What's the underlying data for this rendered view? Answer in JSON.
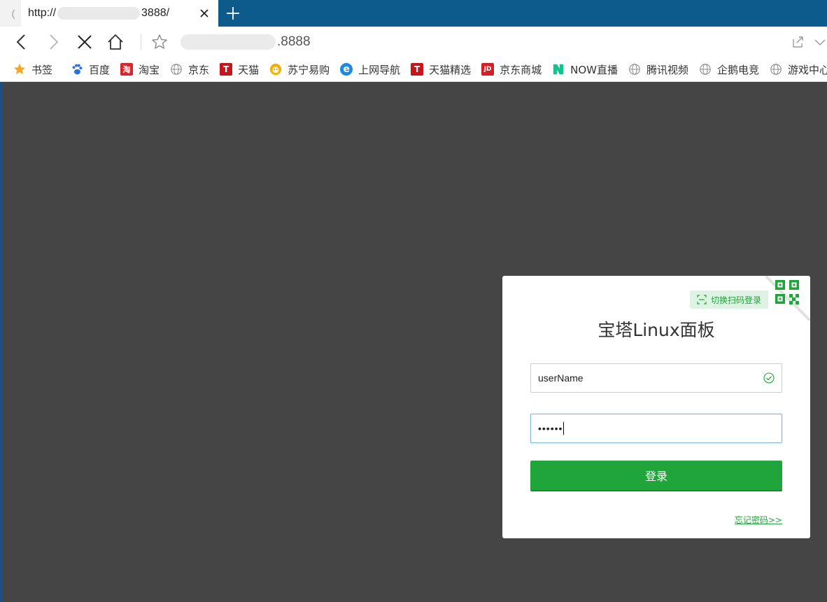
{
  "browser": {
    "tab": {
      "left_mark": "(",
      "title_prefix": "http://",
      "title_suffix": "3888/"
    },
    "address": {
      "suffix": ".8888"
    },
    "bookmarks": [
      {
        "label": "书签",
        "icon": "star-icon",
        "color": "#f5a623"
      },
      {
        "label": "百度",
        "icon": "baidu-paw-icon",
        "color": "#2f6fe0"
      },
      {
        "label": "淘宝",
        "icon": "taobao-icon",
        "color": "#d8262c",
        "glyph": "淘"
      },
      {
        "label": "京东",
        "icon": "globe-icon",
        "color": "#888888"
      },
      {
        "label": "天猫",
        "icon": "tmall-icon",
        "color": "#c4161c",
        "glyph": "T"
      },
      {
        "label": "苏宁易购",
        "icon": "suning-lion-icon",
        "color": "#f2b100"
      },
      {
        "label": "上网导航",
        "icon": "ie-icon",
        "color": "#1e88e5",
        "glyph": "e"
      },
      {
        "label": "天猫精选",
        "icon": "tmall-icon",
        "color": "#c4161c",
        "glyph": "T"
      },
      {
        "label": "京东商城",
        "icon": "jd-icon",
        "color": "#d21f26",
        "glyph": "JD"
      },
      {
        "label": "NOW直播",
        "icon": "now-live-icon",
        "color": "#14c38e"
      },
      {
        "label": "腾讯视频",
        "icon": "globe-icon",
        "color": "#888888"
      },
      {
        "label": "企鹅电竞",
        "icon": "globe-icon",
        "color": "#888888"
      },
      {
        "label": "游戏中心",
        "icon": "globe-icon",
        "color": "#888888"
      }
    ]
  },
  "login": {
    "qr_switch_label": "切换扫码登录",
    "title": "宝塔Linux面板",
    "username_value": "userName",
    "password_mask": "••••••",
    "submit_label": "登录",
    "forgot_label": "忘记密码>>",
    "accent_color": "#20a53a"
  }
}
